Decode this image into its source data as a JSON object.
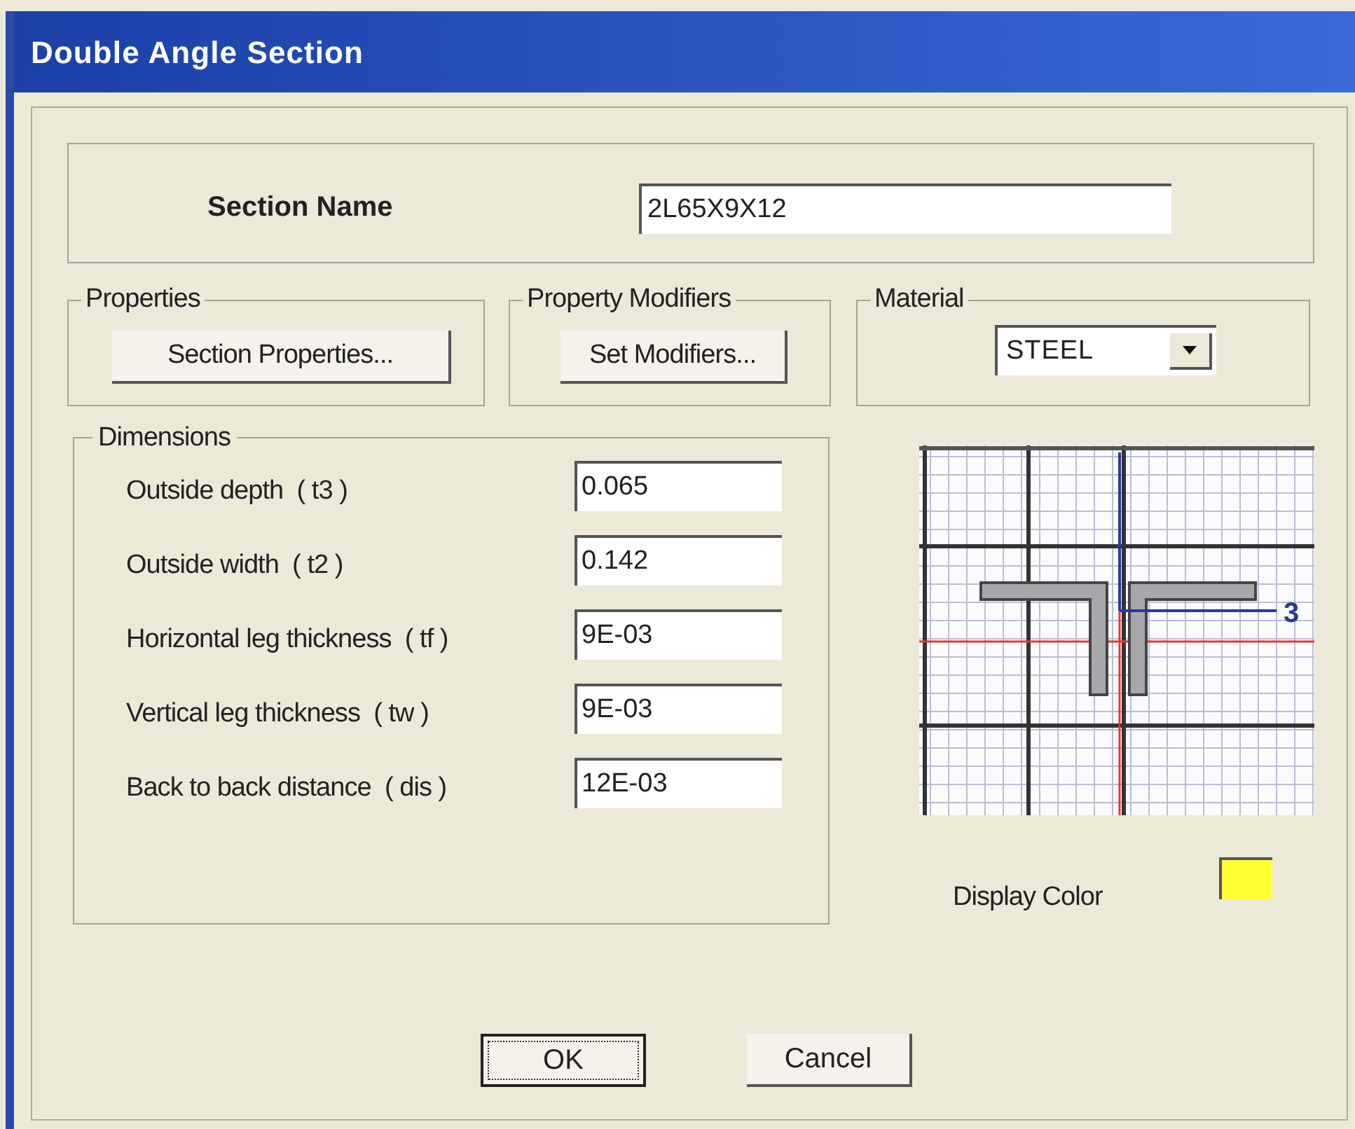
{
  "window": {
    "title": "Double Angle Section"
  },
  "section_name": {
    "label": "Section Name",
    "value": "2L65X9X12"
  },
  "properties": {
    "title": "Properties",
    "button": "Section Properties..."
  },
  "property_modifiers": {
    "title": "Property Modifiers",
    "button": "Set Modifiers..."
  },
  "material": {
    "title": "Material",
    "value": "STEEL"
  },
  "dimensions": {
    "title": "Dimensions",
    "fields": [
      {
        "label": "Outside depth  ( t3 )",
        "value": "0.065"
      },
      {
        "label": "Outside width  ( t2 )",
        "value": "0.142"
      },
      {
        "label": "Horizontal leg thickness  ( tf )",
        "value": "9E-03"
      },
      {
        "label": "Vertical leg thickness  ( tw )",
        "value": "9E-03"
      },
      {
        "label": "Back to back distance  ( dis )",
        "value": "12E-03"
      }
    ]
  },
  "preview": {
    "axis_label": "3"
  },
  "display_color": {
    "label": "Display Color",
    "color": "#ffff33"
  },
  "buttons": [
    {
      "label": "OK",
      "default": true
    },
    {
      "label": "Cancel",
      "default": false
    }
  ]
}
